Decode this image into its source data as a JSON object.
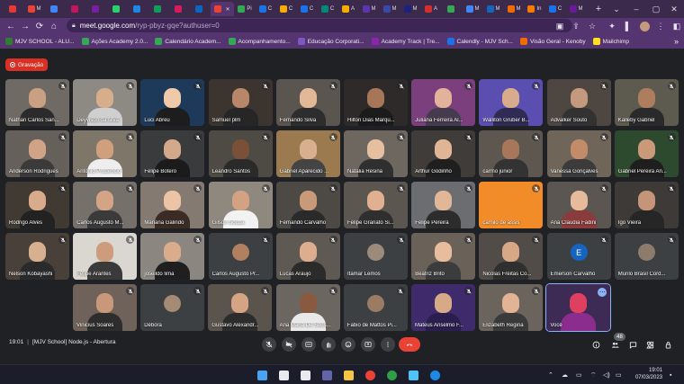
{
  "browser": {
    "tabs": [
      {
        "label": "",
        "color": "#e53935"
      },
      {
        "label": "M",
        "color": "#ea4335"
      },
      {
        "label": "",
        "color": "#4285f4"
      },
      {
        "label": "",
        "color": "#c2185b"
      },
      {
        "label": "",
        "color": "#7b1fa2"
      },
      {
        "label": "",
        "color": "#25d366"
      },
      {
        "label": "",
        "color": "#1e88e5"
      },
      {
        "label": "",
        "color": "#0f9d58"
      },
      {
        "label": "",
        "color": "#d81b60"
      },
      {
        "label": "",
        "color": "#0a66c2"
      },
      {
        "label": "",
        "color": "#ea4335",
        "active": true
      },
      {
        "label": "Pi",
        "color": "#34a853"
      },
      {
        "label": "C",
        "color": "#1a73e8"
      },
      {
        "label": "C",
        "color": "#f9ab00"
      },
      {
        "label": "C",
        "color": "#1a73e8"
      },
      {
        "label": "C",
        "color": "#00897b"
      },
      {
        "label": "A",
        "color": "#f9ab00"
      },
      {
        "label": "M",
        "color": "#5e35b1"
      },
      {
        "label": "M",
        "color": "#3949ab"
      },
      {
        "label": "M",
        "color": "#1a237e"
      },
      {
        "label": "A",
        "color": "#d32f2f"
      },
      {
        "label": "",
        "color": "#34a853"
      },
      {
        "label": "M",
        "color": "#4285f4"
      },
      {
        "label": "M",
        "color": "#1565c0"
      },
      {
        "label": "M",
        "color": "#ef6c00"
      },
      {
        "label": "In",
        "color": "#f57c00"
      },
      {
        "label": "C",
        "color": "#1a73e8"
      },
      {
        "label": "M",
        "color": "#6a1b9a"
      }
    ],
    "new_tab": "+",
    "window_controls": [
      "⌄",
      "–",
      "▢",
      "✕"
    ],
    "url_host": "meet.google.com",
    "url_path": "/ryp-pbyz-gqe?authuser=0"
  },
  "bookmarks": [
    {
      "label": "MJV SCHOOL - ALU...",
      "color": "#2e7d32"
    },
    {
      "label": "Ações Academy 2.0...",
      "color": "#34a853"
    },
    {
      "label": "Calendário Academ...",
      "color": "#34a853"
    },
    {
      "label": "Acompanhamento...",
      "color": "#34a853"
    },
    {
      "label": "Educação Corporati...",
      "color": "#7e57c2"
    },
    {
      "label": "Academy Track | Tre...",
      "color": "#8e24aa"
    },
    {
      "label": "Calendly - MJV Sch...",
      "color": "#1a73e8"
    },
    {
      "label": "Visão Geral - Kenoby",
      "color": "#ef6c00"
    },
    {
      "label": "Mailchimp",
      "color": "#ffe01b"
    }
  ],
  "meet": {
    "recording_label": "Gravação",
    "tiles": [
      {
        "name": "Nathan Carlos San...",
        "bg": "#6f6a63",
        "skin": "#c9a082",
        "shirt": "#2b2b2b"
      },
      {
        "name": "Deyvison da silva",
        "bg": "#8d8a84",
        "skin": "#d7ae8c",
        "shirt": "#cfcfcf"
      },
      {
        "name": "Luci Abreu",
        "bg": "#1e3a5a",
        "skin": "#f0c9a8",
        "shirt": "#1d1d1d"
      },
      {
        "name": "Samuel plm",
        "bg": "#3b342f",
        "skin": "#b8876a",
        "shirt": "#262626"
      },
      {
        "name": "Fernando Silva",
        "bg": "#5b5550",
        "skin": "#e3b896",
        "shirt": "#2d2d2d"
      },
      {
        "name": "Hilton Dias Marqu...",
        "bg": "#2d2a29",
        "skin": "#a77659",
        "shirt": "#1b1b1b"
      },
      {
        "name": "Juliana Ferreira Al...",
        "bg": "#7a3f7c",
        "skin": "#e2b39a",
        "shirt": "#463a4e"
      },
      {
        "name": "Walliton Gruber B...",
        "bg": "#5a4fb0",
        "skin": "#d7ab8b",
        "shirt": "#2f2b54"
      },
      {
        "name": "Advalker Souto",
        "bg": "#4e4640",
        "skin": "#c39a7d",
        "shirt": "#323232"
      },
      {
        "name": "Kalleby Gabriel",
        "bg": "#5d5a4f",
        "skin": "#ad7d5e",
        "shirt": "#2a2a2a"
      },
      {
        "name": "Anderson Rodrigues",
        "bg": "#66605a",
        "skin": "#d0a386",
        "shirt": "#3a3a3a"
      },
      {
        "name": "Antonio Prudencio",
        "bg": "#7e7669",
        "skin": "#cf9f7e",
        "shirt": "#eeeeee"
      },
      {
        "name": "Felipe Botero",
        "bg": "#3a3b3c",
        "skin": "#d4a88a",
        "shirt": "#1b1b1b"
      },
      {
        "name": "Leandro Santos",
        "bg": "#4e4a44",
        "skin": "#7b5038",
        "shirt": "#2a2a2a"
      },
      {
        "name": "Gabriel Aparecido ...",
        "bg": "#9a7a4e",
        "skin": "#d9b08f",
        "shirt": "#444444"
      },
      {
        "name": "Natália Resina",
        "bg": "#6e6760",
        "skin": "#e6bfa0",
        "shirt": "#2f2f2f"
      },
      {
        "name": "Arthur Godinho",
        "bg": "#3f3c3a",
        "skin": "#e0b596",
        "shirt": "#1f1f1f"
      },
      {
        "name": "carmo junior",
        "bg": "#5e5750",
        "skin": "#a8775b",
        "shirt": "#333333"
      },
      {
        "name": "Vanessa Gonçalves",
        "bg": "#6f6559",
        "skin": "#c28c6a",
        "shirt": "#3b3b3b"
      },
      {
        "name": "Gabriel Pereira An...",
        "bg": "#2e4a2e",
        "skin": "#c9997a",
        "shirt": "#1e1e1e"
      },
      {
        "name": "Rodrigo Alves",
        "bg": "#403a33",
        "skin": "#d7ab8b",
        "shirt": "#222222"
      },
      {
        "name": "Carlos Augusto M...",
        "bg": "#75706a",
        "skin": "#d4a486",
        "shirt": "#3a3a3a"
      },
      {
        "name": "Mariana Galindo",
        "bg": "#847a71",
        "skin": "#ecc3a4",
        "shirt": "#3b2b25"
      },
      {
        "name": "Gilson Souza",
        "bg": "#8f887f",
        "skin": "#d3a282",
        "shirt": "#f2f2f2"
      },
      {
        "name": "Fernando Carvalho",
        "bg": "#4d4a45",
        "skin": "#c89a7a",
        "shirt": "#2a2a2a"
      },
      {
        "name": "Felipe Granato Si...",
        "bg": "#5b564f",
        "skin": "#e0b090",
        "shirt": "#2f2f2f"
      },
      {
        "name": "Felipe Pereira",
        "bg": "#6c6d70",
        "skin": "#e2b797",
        "shirt": "#2c2c2c"
      },
      {
        "name": "camilo de assis",
        "bg": "#f28c28",
        "skin": "#f28c28",
        "shirt": "#f28c28"
      },
      {
        "name": "Ana Claudia Fadini",
        "bg": "#5b5651",
        "skin": "#e5bb9c",
        "shirt": "#8a3b3b"
      },
      {
        "name": "Igo Vieira",
        "bg": "#3d3a37",
        "skin": "#c5957a",
        "shirt": "#262626"
      },
      {
        "name": "Nelson Kobayashi",
        "bg": "#4a403a",
        "skin": "#d7b08f",
        "shirt": "#2a2a2a"
      },
      {
        "name": "Felipe Arantes",
        "bg": "#dad6d0",
        "skin": "#cc9c7d",
        "shirt": "#3a3a3a"
      },
      {
        "name": "joseildo lima",
        "bg": "#8b8780",
        "skin": "#d9ad8b",
        "shirt": "#1f1f1f"
      },
      {
        "name": "Carlos Augusto Pr...",
        "bg": "#3c4043",
        "skin": "#b08060",
        "shirt": "#3c4043",
        "avatar": true
      },
      {
        "name": "Lucas Araujo",
        "bg": "#5e5952",
        "skin": "#dcae8e",
        "shirt": "#2b2b2b"
      },
      {
        "name": "Itamar Lemos",
        "bg": "#3c4043",
        "skin": "#9c8a7a",
        "shirt": "#3c4043",
        "avatar": true
      },
      {
        "name": "Beatriz Brito",
        "bg": "#6a6159",
        "skin": "#e8bd9e",
        "shirt": "#3c3c3c"
      },
      {
        "name": "Nicolas Freitas Co...",
        "bg": "#514c47",
        "skin": "#d8a886",
        "shirt": "#2f2f2f"
      },
      {
        "name": "Emerson Carvalho",
        "bg": "#3c4043",
        "skin": "#1565c0",
        "shirt": "#3c4043",
        "avatar": true,
        "initial": "E"
      },
      {
        "name": "Murilo Brasil Cord...",
        "bg": "#3c4043",
        "skin": "#8d7b6b",
        "shirt": "#3c4043",
        "avatar": true
      },
      {
        "name": "Vinicius Soares",
        "bg": "#6f625a",
        "skin": "#c9987a",
        "shirt": "#2d2d2d"
      },
      {
        "name": "Débora",
        "bg": "#3c4043",
        "skin": "#a58a74",
        "shirt": "#3c4043",
        "avatar": true
      },
      {
        "name": "Gustavo Alexandr...",
        "bg": "#5a544d",
        "skin": "#d4a484",
        "shirt": "#2c2c2c"
      },
      {
        "name": "Ana Maria De Sous...",
        "bg": "#6b6660",
        "skin": "#8a5a40",
        "shirt": "#e9e9e9"
      },
      {
        "name": "Fabio de Mattos Pi...",
        "bg": "#3c4043",
        "skin": "#9c7b63",
        "shirt": "#3c4043",
        "avatar": true
      },
      {
        "name": "Mateus Anselmo F...",
        "bg": "#3f2a6b",
        "skin": "#d6a987",
        "shirt": "#2a1e4e"
      },
      {
        "name": "Elizabeth Regina",
        "bg": "#6a645c",
        "skin": "#e2b394",
        "shirt": "#3a3a3a"
      },
      {
        "name": "Você",
        "bg": "#3d2b56",
        "skin": "#e04060",
        "shirt": "#8b2c8f",
        "self": true
      }
    ],
    "meeting_time": "19:01",
    "meeting_title": "[MJV School] Node.js - Abertura",
    "participant_count": "48",
    "end_call_color": "#ea4335"
  },
  "taskbar": {
    "apps": [
      {
        "name": "windows-start-icon",
        "color": "#4aa3f0"
      },
      {
        "name": "search-icon",
        "color": "#e8eaed"
      },
      {
        "name": "task-view-icon",
        "color": "#e8eaed"
      },
      {
        "name": "teams-icon",
        "color": "#6264a7"
      },
      {
        "name": "file-explorer-icon",
        "color": "#f4c542"
      },
      {
        "name": "chrome-icon",
        "color": "#ea4335"
      },
      {
        "name": "edge-dev-icon",
        "color": "#2ea043"
      },
      {
        "name": "notepad-icon",
        "color": "#4fc3f7"
      },
      {
        "name": "edge-icon",
        "color": "#1e88e5"
      }
    ],
    "time": "19:01",
    "date": "07/03/2023"
  }
}
